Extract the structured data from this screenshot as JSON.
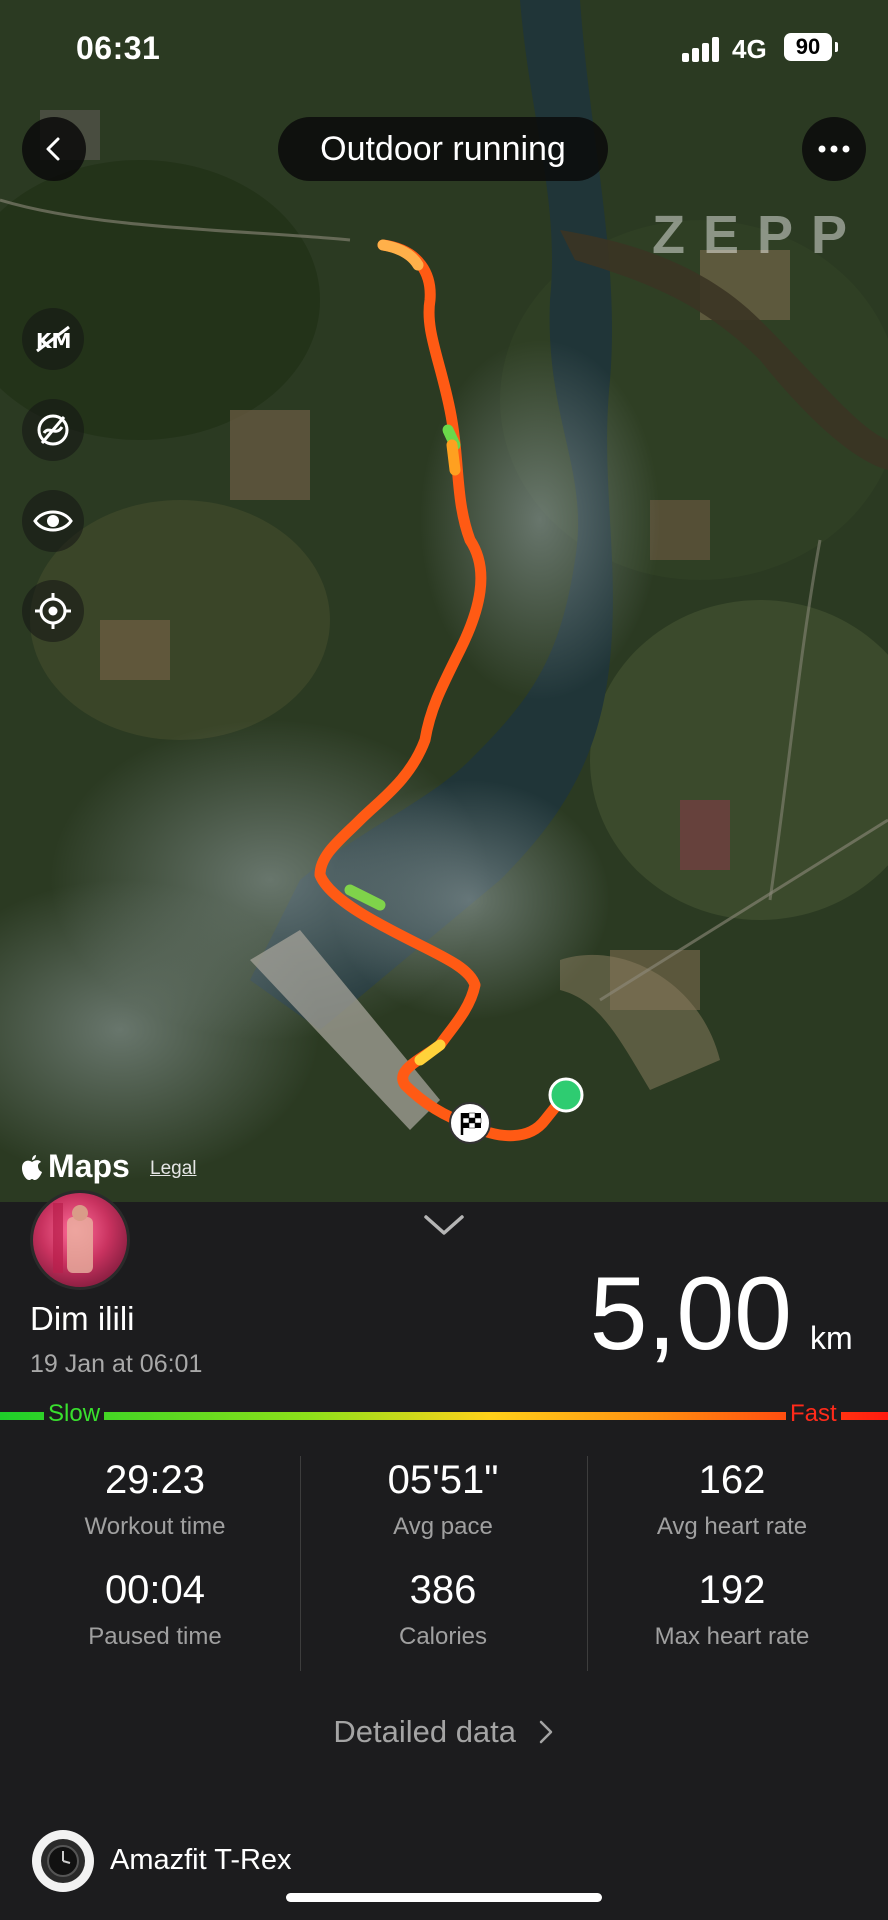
{
  "status_bar": {
    "time": "06:31",
    "network": "4G",
    "battery": "90"
  },
  "header": {
    "title": "Outdoor running",
    "brand_watermark": "ZEPP"
  },
  "map": {
    "provider": "Maps",
    "legal": "Legal"
  },
  "workout": {
    "user_name": "Dim ilili",
    "date": "19 Jan at 06:01",
    "distance": "5,00",
    "distance_unit": "km",
    "pace_scale": {
      "slow": "Slow",
      "fast": "Fast"
    }
  },
  "stats": [
    {
      "value": "29:23",
      "label": "Workout time"
    },
    {
      "value": "05'51\"",
      "label": "Avg pace"
    },
    {
      "value": "162",
      "label": "Avg heart rate"
    },
    {
      "value": "00:04",
      "label": "Paused time"
    },
    {
      "value": "386",
      "label": "Calories"
    },
    {
      "value": "192",
      "label": "Max heart rate"
    }
  ],
  "detailed_link": "Detailed data",
  "device": {
    "name": "Amazfit T-Rex"
  },
  "colors": {
    "route": "#ff5a14",
    "slow": "#39e02e",
    "fast": "#ff2a1a",
    "start_marker": "#2ecc71"
  }
}
